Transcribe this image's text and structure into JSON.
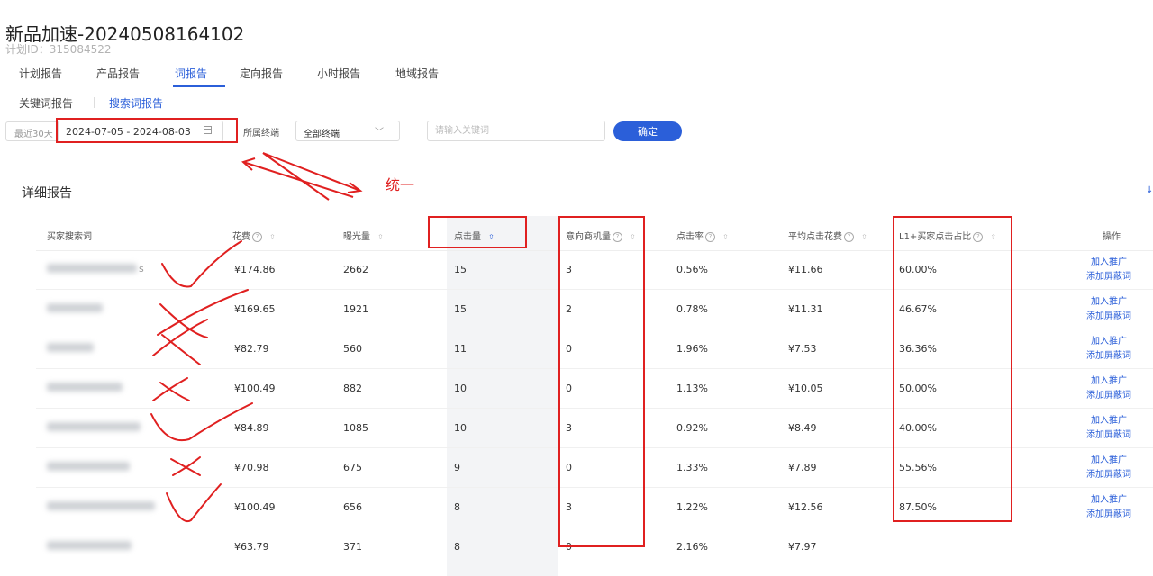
{
  "header": {
    "title": "新品加速-20240508164102",
    "plan_id": "计划ID：315084522"
  },
  "tabs": [
    {
      "label": "计划报告"
    },
    {
      "label": "产品报告"
    },
    {
      "label": "词报告",
      "active": true
    },
    {
      "label": "定向报告"
    },
    {
      "label": "小时报告"
    },
    {
      "label": "地域报告"
    }
  ],
  "subtabs": [
    {
      "label": "关键词报告"
    },
    {
      "label": "搜索词报告",
      "active": true
    }
  ],
  "filters": {
    "preset": "最近30天",
    "date_range": "2024-07-05 - 2024-08-03",
    "terminal_label": "所属终端",
    "terminal_value": "全部终端",
    "keyword_placeholder": "请输入关键词",
    "confirm": "确定"
  },
  "section": {
    "title": "详细报告"
  },
  "table": {
    "headers": {
      "keyword": "买家搜索词",
      "cost": "花费",
      "impressions": "曝光量",
      "clicks": "点击量",
      "inquiries": "意向商机量",
      "ctr": "点击率",
      "avg_cpc": "平均点击花费",
      "l1_ratio": "L1+买家点击占比",
      "ops": "操作"
    },
    "rows": [
      {
        "kw_tail": "s",
        "cost": "¥174.86",
        "impressions": "2662",
        "clicks": "15",
        "inquiries": "3",
        "ctr": "0.56%",
        "avg_cpc": "¥11.66",
        "l1_ratio": "60.00%",
        "op1": "加入推广",
        "op2": "添加屏蔽词"
      },
      {
        "kw_tail": "",
        "cost": "¥169.65",
        "impressions": "1921",
        "clicks": "15",
        "inquiries": "2",
        "ctr": "0.78%",
        "avg_cpc": "¥11.31",
        "l1_ratio": "46.67%",
        "op1": "加入推广",
        "op2": "添加屏蔽词"
      },
      {
        "kw_tail": "",
        "cost": "¥82.79",
        "impressions": "560",
        "clicks": "11",
        "inquiries": "0",
        "ctr": "1.96%",
        "avg_cpc": "¥7.53",
        "l1_ratio": "36.36%",
        "op1": "加入推广",
        "op2": "添加屏蔽词"
      },
      {
        "kw_tail": "",
        "cost": "¥100.49",
        "impressions": "882",
        "clicks": "10",
        "inquiries": "0",
        "ctr": "1.13%",
        "avg_cpc": "¥10.05",
        "l1_ratio": "50.00%",
        "op1": "加入推广",
        "op2": "添加屏蔽词"
      },
      {
        "kw_tail": "",
        "cost": "¥84.89",
        "impressions": "1085",
        "clicks": "10",
        "inquiries": "3",
        "ctr": "0.92%",
        "avg_cpc": "¥8.49",
        "l1_ratio": "40.00%",
        "op1": "加入推广",
        "op2": "添加屏蔽词"
      },
      {
        "kw_tail": "",
        "cost": "¥70.98",
        "impressions": "675",
        "clicks": "9",
        "inquiries": "0",
        "ctr": "1.33%",
        "avg_cpc": "¥7.89",
        "l1_ratio": "55.56%",
        "op1": "加入推广",
        "op2": "添加屏蔽词"
      },
      {
        "kw_tail": "",
        "cost": "¥100.49",
        "impressions": "656",
        "clicks": "8",
        "inquiries": "3",
        "ctr": "1.22%",
        "avg_cpc": "¥12.56",
        "l1_ratio": "87.50%",
        "op1": "加入推广",
        "op2": "添加屏蔽词"
      },
      {
        "kw_tail": "",
        "cost": "¥63.79",
        "impressions": "371",
        "clicks": "8",
        "inquiries": "0",
        "ctr": "2.16%",
        "avg_cpc": "¥7.97",
        "l1_ratio": "",
        "op1": "",
        "op2": ""
      }
    ]
  },
  "annotation": {
    "text": "统一",
    "color": "#e02020",
    "marks": [
      "check",
      "cross",
      "cross",
      "cross",
      "check",
      "cross",
      "check"
    ]
  }
}
